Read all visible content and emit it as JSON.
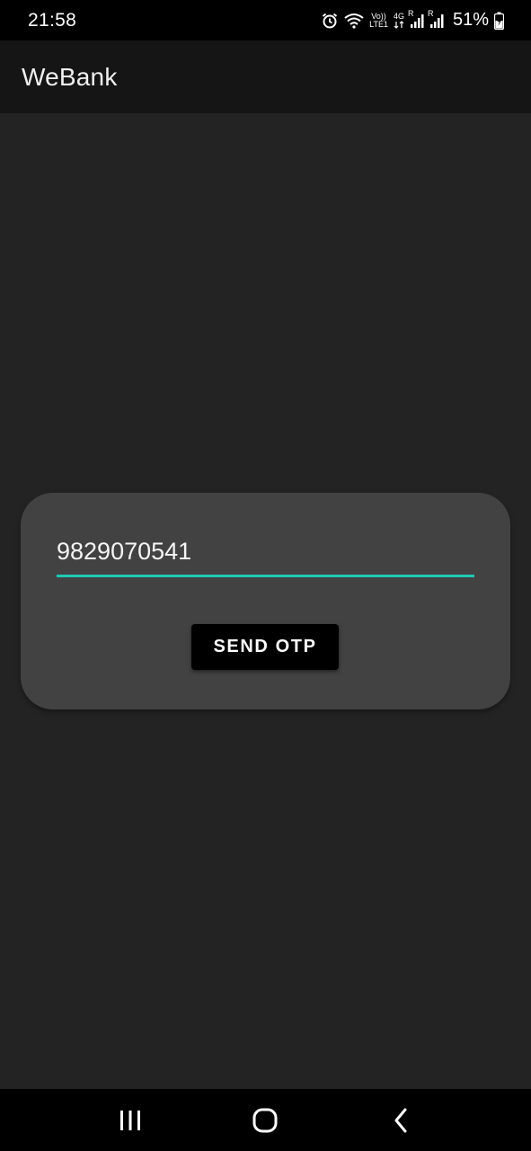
{
  "status_bar": {
    "time": "21:58",
    "volte_label_top": "Vo))",
    "volte_label_bottom": "LTE1",
    "network_4g": "4G",
    "roaming_1": "R",
    "roaming_2": "R",
    "battery": "51%"
  },
  "app_bar": {
    "title": "WeBank"
  },
  "otp_card": {
    "phone_value": "9829070541",
    "send_button_label": "SEND OTP"
  },
  "colors": {
    "background": "#232323",
    "app_bar": "#151515",
    "card": "#424242",
    "input_underline": "#1fc7b6",
    "button": "#000000"
  },
  "nav_bar": {
    "recents_icon": "recents-icon",
    "home_icon": "home-icon",
    "back_icon": "back-icon"
  }
}
